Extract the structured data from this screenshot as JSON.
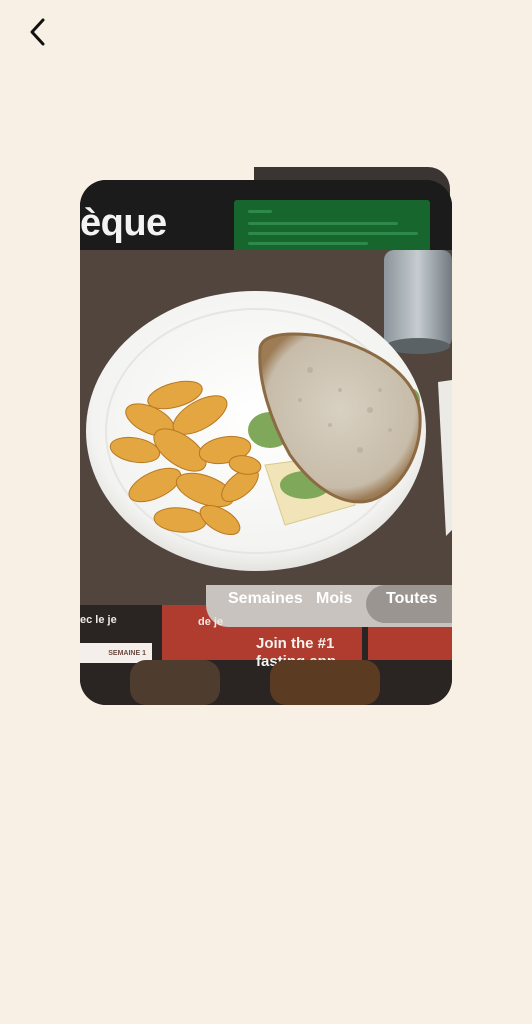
{
  "nav": {
    "back_icon": "chevron-left-icon"
  },
  "card": {
    "photo_alt": "Sandwich with potato chips on a white plate",
    "background": {
      "title_fragment": "èque",
      "strip_text_left": "ec le je",
      "strip_text_mid": "de je",
      "join_text_line1": "Join the #1",
      "join_text_line2": "fasting app",
      "week_label": "SEMAINE 1",
      "segment_months": "Mois",
      "segment_all": "Toutes",
      "segment_weeks": "Semaines"
    }
  },
  "colors": {
    "page_bg": "#f8efe5",
    "accent_red": "#b03c2f",
    "dark": "#141414"
  }
}
